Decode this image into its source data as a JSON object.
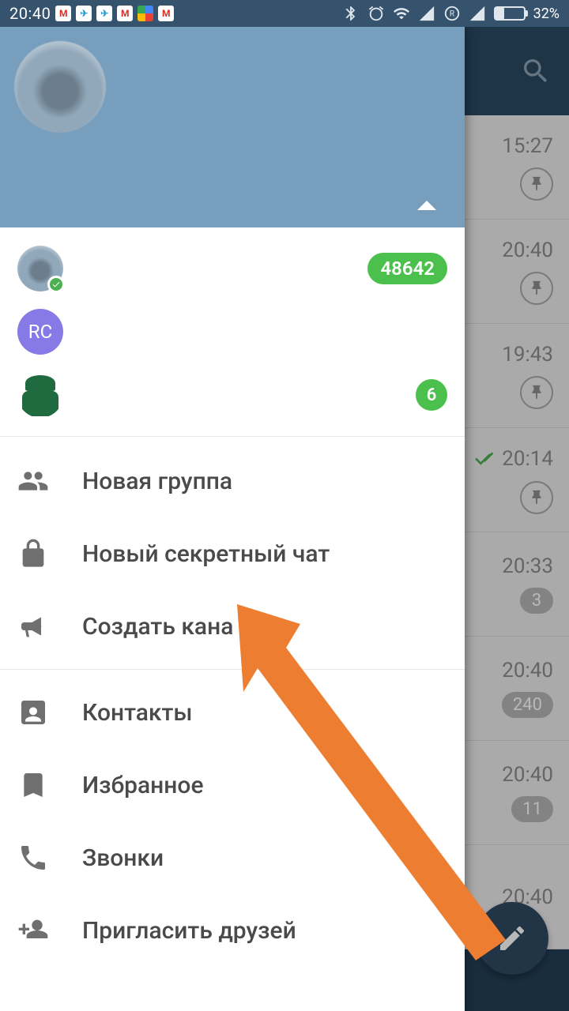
{
  "status": {
    "time": "20:40",
    "battery_pct": "32%",
    "battery_level": 32
  },
  "bg_chats": [
    {
      "time": "15:27",
      "pin": true
    },
    {
      "time": "20:40",
      "pin": true
    },
    {
      "time": "19:43",
      "pin": true
    },
    {
      "time": "20:14",
      "pin": true,
      "read": true
    },
    {
      "time": "20:33",
      "count": "3"
    },
    {
      "time": "20:40",
      "count": "240"
    },
    {
      "time": "20:40",
      "count": "11"
    },
    {
      "time": "20:40"
    }
  ],
  "accounts": [
    {
      "badge": "48642",
      "avatar": "blur",
      "online": true
    },
    {
      "avatar": "RC"
    },
    {
      "avatar": "spy",
      "badge": "6",
      "circle": true
    }
  ],
  "menu": {
    "new_group": "Новая группа",
    "new_secret": "Новый секретный чат",
    "new_channel": "Создать кана",
    "contacts": "Контакты",
    "saved": "Избранное",
    "calls": "Звонки",
    "invite": "Пригласить друзей"
  }
}
